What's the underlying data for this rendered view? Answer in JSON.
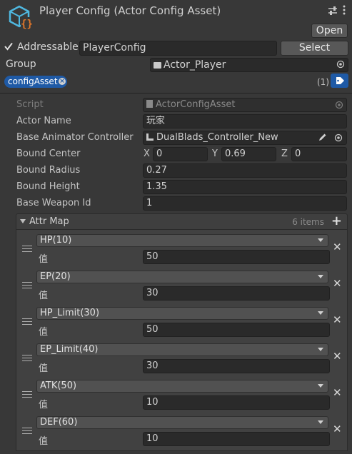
{
  "header": {
    "title": "Player Config (Actor Config Asset)",
    "open_label": "Open",
    "addressable_label": "Addressable",
    "addressable_checked": true,
    "address_value": "PlayerConfig",
    "select_label": "Select",
    "group_label": "Group",
    "group_value": "Actor_Player",
    "tag_label": "configAsset",
    "label_count": "(1)"
  },
  "fields": {
    "script_label": "Script",
    "script_value": "ActorConfigAsset",
    "actor_name_label": "Actor Name",
    "actor_name_value": "玩家",
    "animator_label": "Base Animator Controller",
    "animator_value": "DualBlads_Controller_New",
    "bound_center_label": "Bound Center",
    "x_label": "X",
    "x_value": "0",
    "y_label": "Y",
    "y_value": "0.69",
    "z_label": "Z",
    "z_value": "0",
    "bound_radius_label": "Bound Radius",
    "bound_radius_value": "0.27",
    "bound_height_label": "Bound Height",
    "bound_height_value": "1.35",
    "weapon_id_label": "Base Weapon Id",
    "weapon_id_value": "1"
  },
  "attr_map": {
    "title": "Attr Map",
    "count": "6 items",
    "items": [
      {
        "key": "HP(10)",
        "value_label": "值",
        "value": "50"
      },
      {
        "key": "EP(20)",
        "value_label": "值",
        "value": "30"
      },
      {
        "key": "HP_Limit(30)",
        "value_label": "值",
        "value": "50"
      },
      {
        "key": "EP_Limit(40)",
        "value_label": "值",
        "value": "30"
      },
      {
        "key": "ATK(50)",
        "value_label": "值",
        "value": "10"
      },
      {
        "key": "DEF(60)",
        "value_label": "值",
        "value": "10"
      }
    ]
  },
  "colors": {
    "background": "#383838",
    "field": "#2a2a2a",
    "tag_blue": "#1f5aa6",
    "icon_cyan": "#4fb8e0",
    "icon_orange": "#e0762a"
  }
}
